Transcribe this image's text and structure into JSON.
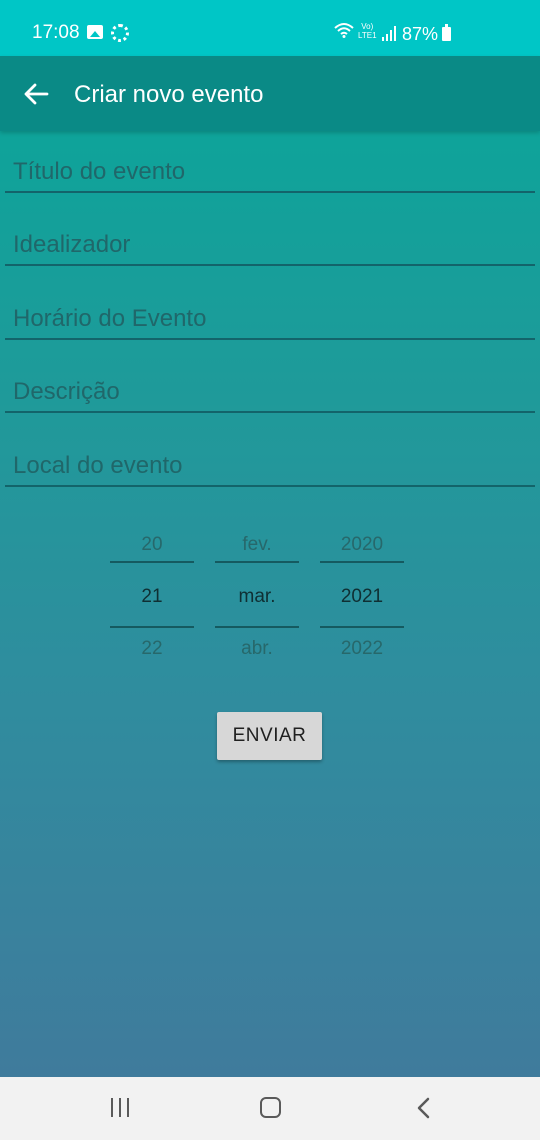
{
  "status_bar": {
    "time": "17:08",
    "lte_line1": "Vo)",
    "lte_line2": "LTE1",
    "battery": "87%",
    "background": "#00c6c6"
  },
  "toolbar": {
    "title": "Criar novo evento",
    "back_icon": "arrow-left-icon",
    "background": "#0a8a86"
  },
  "form": {
    "titulo_placeholder": "Título do evento",
    "idealizador_placeholder": "Idealizador",
    "horario_placeholder": "Horário do Evento",
    "descricao_placeholder": "Descrição",
    "local_placeholder": "Local do evento"
  },
  "date_picker": {
    "day": {
      "prev": "20",
      "current": "21",
      "next": "22"
    },
    "month": {
      "prev": "fev.",
      "current": "mar.",
      "next": "abr."
    },
    "year": {
      "prev": "2020",
      "current": "2021",
      "next": "2022"
    }
  },
  "submit": {
    "label": "ENVIAR"
  },
  "nav_bar": {
    "icons": [
      "recent-apps-icon",
      "home-icon",
      "back-icon"
    ]
  }
}
